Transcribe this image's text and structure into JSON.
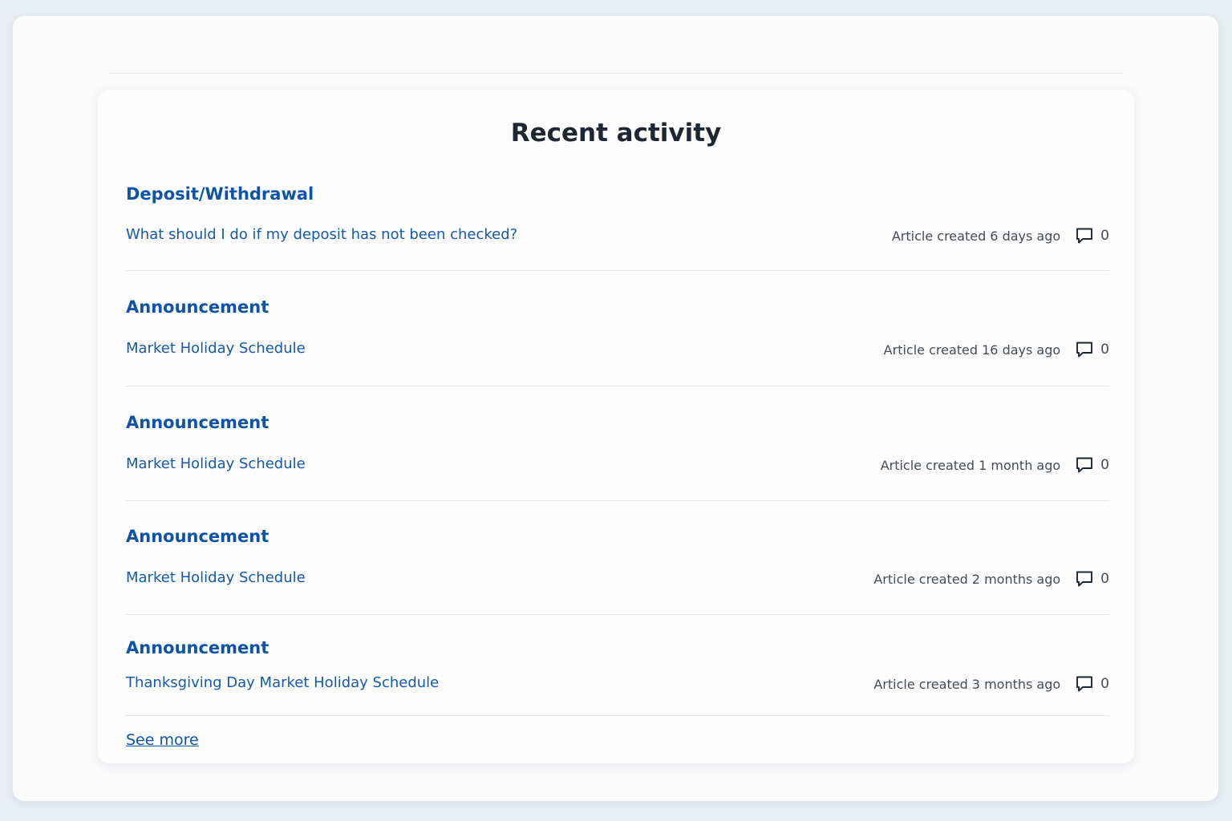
{
  "title": "Recent activity",
  "items": [
    {
      "section": "Deposit/Withdrawal",
      "article": "What should I do if my deposit has not been checked?",
      "meta": "Article created 6 days ago",
      "comments": "0"
    },
    {
      "section": "Announcement",
      "article": "Market Holiday Schedule",
      "meta": "Article created 16 days ago",
      "comments": "0"
    },
    {
      "section": "Announcement",
      "article": "Market Holiday Schedule",
      "meta": "Article created 1 month ago",
      "comments": "0"
    },
    {
      "section": "Announcement",
      "article": "Market Holiday Schedule",
      "meta": "Article created 2 months ago",
      "comments": "0"
    },
    {
      "section": "Announcement",
      "article": "Thanksgiving Day Market Holiday Schedule",
      "meta": "Article created 3 months ago",
      "comments": "0"
    }
  ],
  "see_more": "See more",
  "icons": {
    "comment": "comment-icon"
  },
  "colors": {
    "link": "#1459ad",
    "heading": "#0d53a8",
    "title": "#1c2733"
  }
}
